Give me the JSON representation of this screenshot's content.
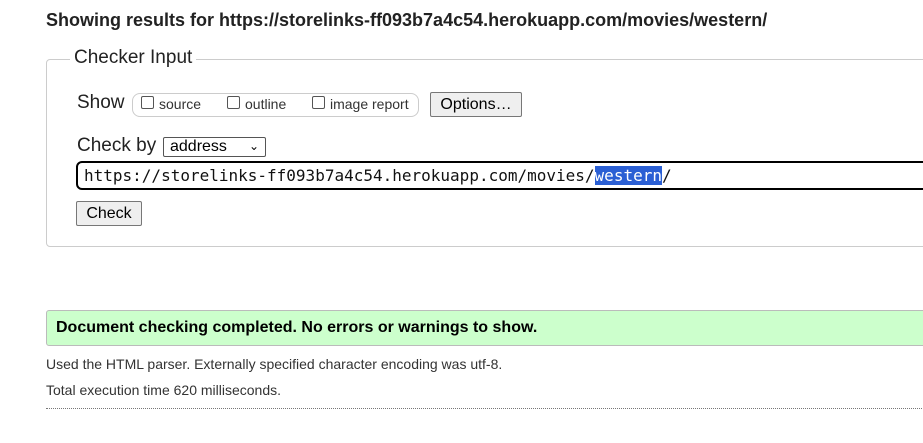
{
  "header": {
    "title": "Showing results for https://storelinks-ff093b7a4c54.herokuapp.com/movies/western/"
  },
  "checker": {
    "legend": "Checker Input",
    "show_label": "Show",
    "show_options": [
      {
        "label": "source",
        "checked": false
      },
      {
        "label": "outline",
        "checked": false
      },
      {
        "label": "image report",
        "checked": false
      }
    ],
    "options_button": "Options…",
    "check_by_label": "Check by",
    "check_by_value": "address",
    "url_prefix": "https://storelinks-ff093b7a4c54.herokuapp.com/movies/",
    "url_selected": "western",
    "url_suffix": "/",
    "check_button": "Check"
  },
  "result": {
    "message": "Document checking completed. No errors or warnings to show.",
    "parser_info": "Used the HTML parser. Externally specified character encoding was utf-8.",
    "exec_time": "Total execution time 620 milliseconds."
  }
}
